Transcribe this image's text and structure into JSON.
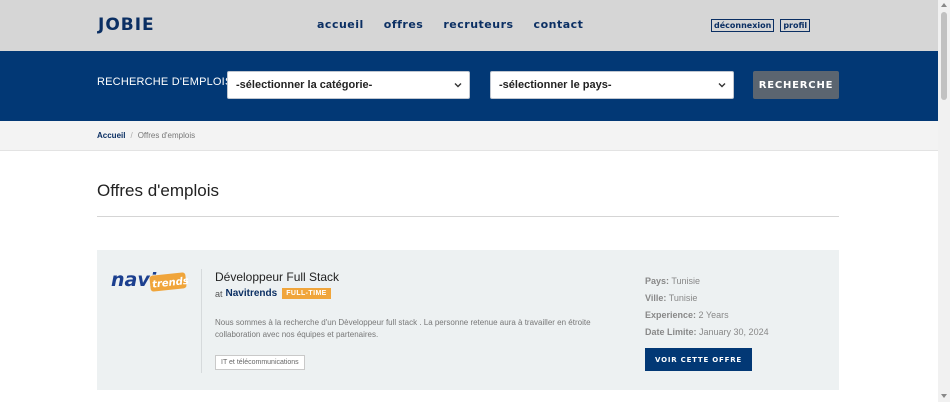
{
  "header": {
    "logo": "JOBIE",
    "nav": [
      "accueil",
      "offres",
      "recruteurs",
      "contact"
    ],
    "logout_label": "déconnexion",
    "profile_label": "profil"
  },
  "search": {
    "label": "RECHERCHE D'EMPLOIS",
    "category_select": "-sélectionner la catégorie-",
    "country_select": "-sélectionner le pays-",
    "button_label": "RECHERCHE"
  },
  "breadcrumb": {
    "home": "Accueil",
    "separator": "/",
    "current": "Offres d'emplois"
  },
  "page_title": "Offres d'emplois",
  "jobs": [
    {
      "brand_logo": "navitrends-logo",
      "title": "Développeur Full Stack",
      "at": "at",
      "company": "Navitrends",
      "contract": "FULL-TIME",
      "description": "Nous sommes à la recherche d'un Dèveloppeur full stack . La personne retenue aura à travailler en étroite collaboration avec nos équipes et partenaires.",
      "tag": "IT et télécommunications",
      "country_label": "Pays:",
      "country": "Tunisie",
      "city_label": "Ville:",
      "city": "Tunisie",
      "experience_label": "Experience:",
      "experience": "2 Years",
      "deadline_label": "Date Limite:",
      "deadline": "January 30, 2024",
      "view_label": "VOIR CETTE OFFRE"
    }
  ],
  "colors": {
    "navy": "#023875",
    "dark_text": "#0b2f63",
    "badge": "#f0a53b",
    "card_bg": "#edf1f2"
  }
}
